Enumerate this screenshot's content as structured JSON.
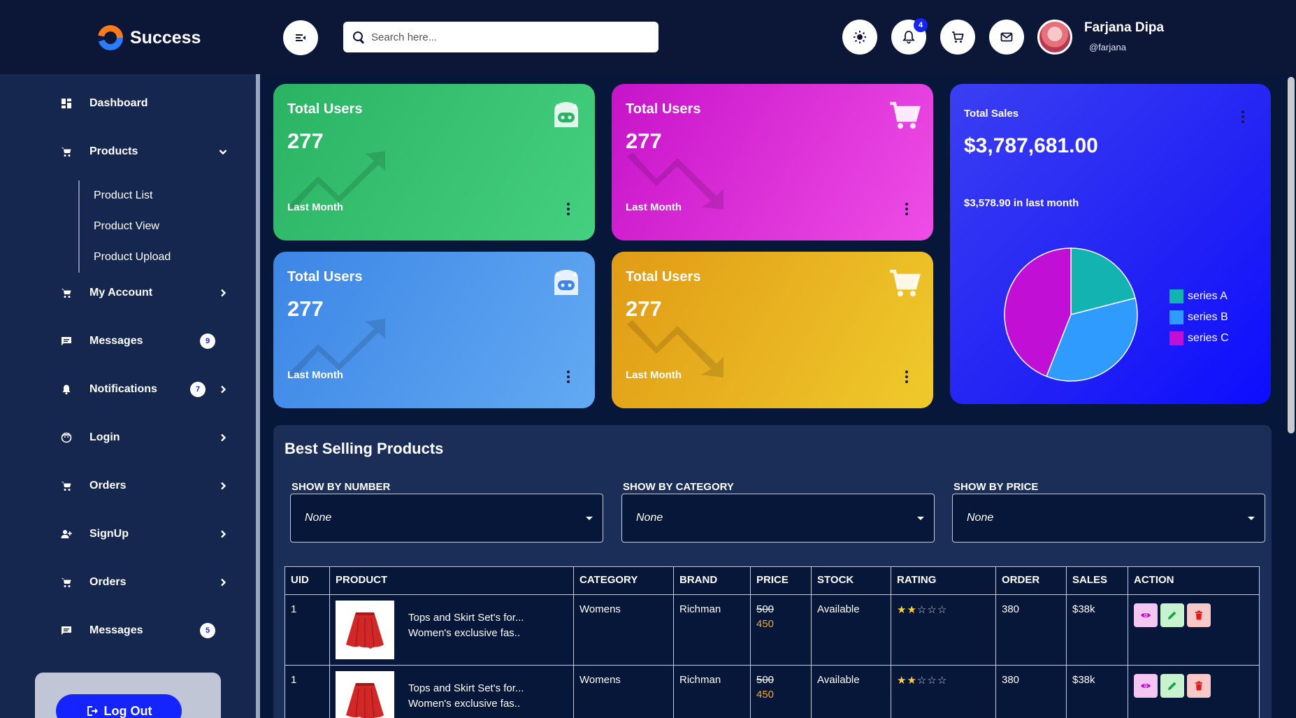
{
  "header": {
    "brand": "Success",
    "search_placeholder": "Search here...",
    "notification_count": "4",
    "user": {
      "name": "Farjana Dipa",
      "handle": "@farjana"
    }
  },
  "sidebar": {
    "items": [
      {
        "label": "Dashboard"
      },
      {
        "label": "Products"
      },
      {
        "label": "My Account"
      },
      {
        "label": "Messages",
        "count": "9"
      },
      {
        "label": "Notifications",
        "count": "7"
      },
      {
        "label": "Login"
      },
      {
        "label": "Orders"
      },
      {
        "label": "SignUp"
      },
      {
        "label": "Orders"
      },
      {
        "label": "Messages",
        "count": "5"
      }
    ],
    "submenu": [
      "Product List",
      "Product View",
      "Product Upload"
    ],
    "logout_label": "Log Out"
  },
  "cards": [
    {
      "title": "Total Users",
      "value": "277",
      "sub": "Last Month",
      "trend": "up",
      "icon": "bot-icon",
      "gradient": [
        "#2bb364",
        "#44d07f"
      ]
    },
    {
      "title": "Total Users",
      "value": "277",
      "sub": "Last Month",
      "trend": "down",
      "icon": "cart-icon",
      "gradient": [
        "#c713c9",
        "#ef4de6"
      ]
    },
    {
      "title": "Total Users",
      "value": "277",
      "sub": "Last Month",
      "trend": "up",
      "icon": "bot-icon",
      "gradient": [
        "#3d86e6",
        "#62aaf2"
      ]
    },
    {
      "title": "Total Users",
      "value": "277",
      "sub": "Last Month",
      "trend": "down",
      "icon": "cart-icon",
      "gradient": [
        "#e19b16",
        "#efca2c"
      ]
    }
  ],
  "sales": {
    "title": "Total Sales",
    "value": "$3,787,681.00",
    "sub": "$3,578.90 in last month"
  },
  "chart_data": {
    "type": "pie",
    "labels": [
      "series A",
      "series B",
      "series C"
    ],
    "values": [
      21,
      35,
      44
    ],
    "colors": [
      "#12b3b0",
      "#2f9bff",
      "#c10fd6"
    ]
  },
  "products_panel": {
    "title": "Best Selling Products",
    "filters": [
      {
        "label": "SHOW BY NUMBER",
        "value": "None"
      },
      {
        "label": "SHOW BY CATEGORY",
        "value": "None"
      },
      {
        "label": "SHOW BY PRICE",
        "value": "None"
      }
    ],
    "columns": [
      "UID",
      "PRODUCT",
      "CATEGORY",
      "BRAND",
      "PRICE",
      "STOCK",
      "RATING",
      "ORDER",
      "SALES",
      "ACTION"
    ],
    "rows": [
      {
        "uid": "1",
        "product_line1": "Tops and Skirt Set's for...",
        "product_line2": "Women's exclusive fas..",
        "category": "Womens",
        "brand": "Richman",
        "price_old": "500",
        "price_new": "450",
        "stock": "Available",
        "rating": 2,
        "order": "380",
        "sales": "$38k"
      },
      {
        "uid": "1",
        "product_line1": "Tops and Skirt Set's for...",
        "product_line2": "Women's exclusive fas..",
        "category": "Womens",
        "brand": "Richman",
        "price_old": "500",
        "price_new": "450",
        "stock": "Available",
        "rating": 2,
        "order": "380",
        "sales": "$38k"
      }
    ]
  }
}
